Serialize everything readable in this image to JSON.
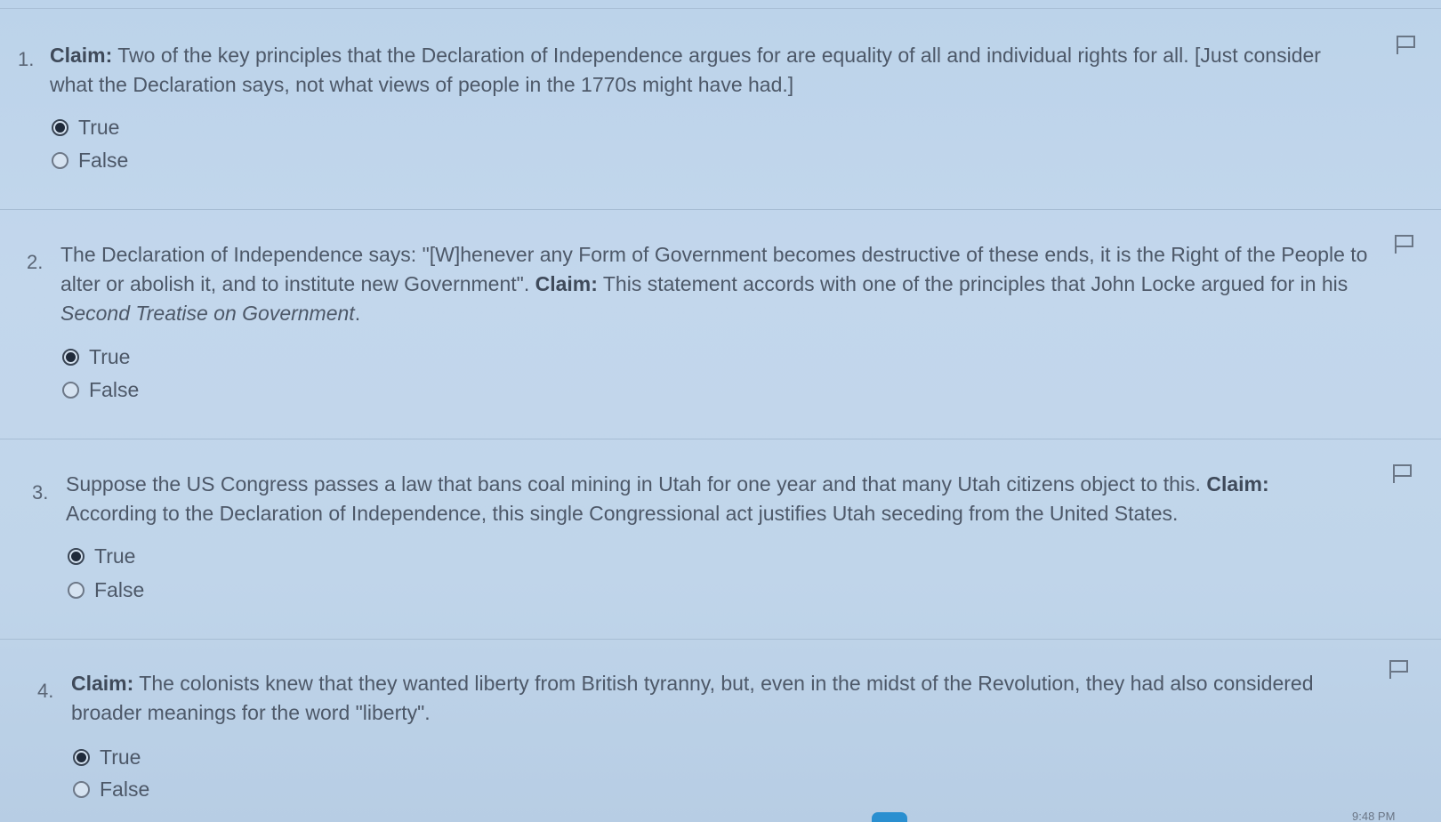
{
  "questions": [
    {
      "number": "1.",
      "claim_label": "Claim:",
      "text_before": "",
      "text_after": " Two of the key principles that the Declaration of Independence argues for are equality of all and individual rights for all. [Just consider what the Declaration says, not what views of people in the 1770s might have had.]",
      "italic": "",
      "text_tail": "",
      "options": [
        "True",
        "False"
      ],
      "selected": "True"
    },
    {
      "number": "2.",
      "claim_label": "Claim:",
      "text_before": "The Declaration of Independence says: \"[W]henever any Form of Government becomes destructive of these ends, it is the Right of the People to alter or abolish it, and to institute new Government\". ",
      "text_after": " This statement accords with one of the principles that John Locke argued for in his ",
      "italic": "Second Treatise on Government",
      "text_tail": ".",
      "options": [
        "True",
        "False"
      ],
      "selected": "True"
    },
    {
      "number": "3.",
      "claim_label": "Claim:",
      "text_before": "Suppose the US Congress passes a law that bans coal mining in Utah for one year and that many Utah citizens object to this. ",
      "text_after": " According to the Declaration of Independence, this single Congressional act justifies Utah seceding from the United States.",
      "italic": "",
      "text_tail": "",
      "options": [
        "True",
        "False"
      ],
      "selected": "True"
    },
    {
      "number": "4.",
      "claim_label": "Claim:",
      "text_before": "",
      "text_after": " The colonists knew that they wanted liberty from British tyranny, but, even in the midst of the Revolution, they had also considered broader meanings for the word \"liberty\".",
      "italic": "",
      "text_tail": "",
      "options": [
        "True",
        "False"
      ],
      "selected": "True"
    }
  ],
  "flag_icon": "flag-icon",
  "clock_text": "9:48 PM",
  "colors": {
    "background": "#c0d5ea",
    "text": "#4d5868",
    "radio_selected": "#1f2a3a"
  }
}
